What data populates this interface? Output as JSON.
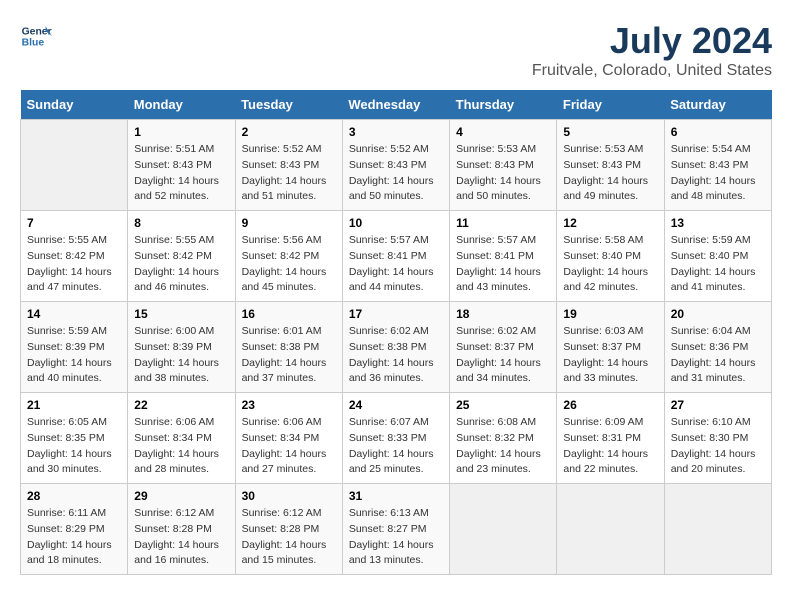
{
  "header": {
    "logo_line1": "General",
    "logo_line2": "Blue",
    "title": "July 2024",
    "subtitle": "Fruitvale, Colorado, United States"
  },
  "calendar": {
    "headers": [
      "Sunday",
      "Monday",
      "Tuesday",
      "Wednesday",
      "Thursday",
      "Friday",
      "Saturday"
    ],
    "weeks": [
      [
        {
          "day": "",
          "info": ""
        },
        {
          "day": "1",
          "info": "Sunrise: 5:51 AM\nSunset: 8:43 PM\nDaylight: 14 hours\nand 52 minutes."
        },
        {
          "day": "2",
          "info": "Sunrise: 5:52 AM\nSunset: 8:43 PM\nDaylight: 14 hours\nand 51 minutes."
        },
        {
          "day": "3",
          "info": "Sunrise: 5:52 AM\nSunset: 8:43 PM\nDaylight: 14 hours\nand 50 minutes."
        },
        {
          "day": "4",
          "info": "Sunrise: 5:53 AM\nSunset: 8:43 PM\nDaylight: 14 hours\nand 50 minutes."
        },
        {
          "day": "5",
          "info": "Sunrise: 5:53 AM\nSunset: 8:43 PM\nDaylight: 14 hours\nand 49 minutes."
        },
        {
          "day": "6",
          "info": "Sunrise: 5:54 AM\nSunset: 8:43 PM\nDaylight: 14 hours\nand 48 minutes."
        }
      ],
      [
        {
          "day": "7",
          "info": "Sunrise: 5:55 AM\nSunset: 8:42 PM\nDaylight: 14 hours\nand 47 minutes."
        },
        {
          "day": "8",
          "info": "Sunrise: 5:55 AM\nSunset: 8:42 PM\nDaylight: 14 hours\nand 46 minutes."
        },
        {
          "day": "9",
          "info": "Sunrise: 5:56 AM\nSunset: 8:42 PM\nDaylight: 14 hours\nand 45 minutes."
        },
        {
          "day": "10",
          "info": "Sunrise: 5:57 AM\nSunset: 8:41 PM\nDaylight: 14 hours\nand 44 minutes."
        },
        {
          "day": "11",
          "info": "Sunrise: 5:57 AM\nSunset: 8:41 PM\nDaylight: 14 hours\nand 43 minutes."
        },
        {
          "day": "12",
          "info": "Sunrise: 5:58 AM\nSunset: 8:40 PM\nDaylight: 14 hours\nand 42 minutes."
        },
        {
          "day": "13",
          "info": "Sunrise: 5:59 AM\nSunset: 8:40 PM\nDaylight: 14 hours\nand 41 minutes."
        }
      ],
      [
        {
          "day": "14",
          "info": "Sunrise: 5:59 AM\nSunset: 8:39 PM\nDaylight: 14 hours\nand 40 minutes."
        },
        {
          "day": "15",
          "info": "Sunrise: 6:00 AM\nSunset: 8:39 PM\nDaylight: 14 hours\nand 38 minutes."
        },
        {
          "day": "16",
          "info": "Sunrise: 6:01 AM\nSunset: 8:38 PM\nDaylight: 14 hours\nand 37 minutes."
        },
        {
          "day": "17",
          "info": "Sunrise: 6:02 AM\nSunset: 8:38 PM\nDaylight: 14 hours\nand 36 minutes."
        },
        {
          "day": "18",
          "info": "Sunrise: 6:02 AM\nSunset: 8:37 PM\nDaylight: 14 hours\nand 34 minutes."
        },
        {
          "day": "19",
          "info": "Sunrise: 6:03 AM\nSunset: 8:37 PM\nDaylight: 14 hours\nand 33 minutes."
        },
        {
          "day": "20",
          "info": "Sunrise: 6:04 AM\nSunset: 8:36 PM\nDaylight: 14 hours\nand 31 minutes."
        }
      ],
      [
        {
          "day": "21",
          "info": "Sunrise: 6:05 AM\nSunset: 8:35 PM\nDaylight: 14 hours\nand 30 minutes."
        },
        {
          "day": "22",
          "info": "Sunrise: 6:06 AM\nSunset: 8:34 PM\nDaylight: 14 hours\nand 28 minutes."
        },
        {
          "day": "23",
          "info": "Sunrise: 6:06 AM\nSunset: 8:34 PM\nDaylight: 14 hours\nand 27 minutes."
        },
        {
          "day": "24",
          "info": "Sunrise: 6:07 AM\nSunset: 8:33 PM\nDaylight: 14 hours\nand 25 minutes."
        },
        {
          "day": "25",
          "info": "Sunrise: 6:08 AM\nSunset: 8:32 PM\nDaylight: 14 hours\nand 23 minutes."
        },
        {
          "day": "26",
          "info": "Sunrise: 6:09 AM\nSunset: 8:31 PM\nDaylight: 14 hours\nand 22 minutes."
        },
        {
          "day": "27",
          "info": "Sunrise: 6:10 AM\nSunset: 8:30 PM\nDaylight: 14 hours\nand 20 minutes."
        }
      ],
      [
        {
          "day": "28",
          "info": "Sunrise: 6:11 AM\nSunset: 8:29 PM\nDaylight: 14 hours\nand 18 minutes."
        },
        {
          "day": "29",
          "info": "Sunrise: 6:12 AM\nSunset: 8:28 PM\nDaylight: 14 hours\nand 16 minutes."
        },
        {
          "day": "30",
          "info": "Sunrise: 6:12 AM\nSunset: 8:28 PM\nDaylight: 14 hours\nand 15 minutes."
        },
        {
          "day": "31",
          "info": "Sunrise: 6:13 AM\nSunset: 8:27 PM\nDaylight: 14 hours\nand 13 minutes."
        },
        {
          "day": "",
          "info": ""
        },
        {
          "day": "",
          "info": ""
        },
        {
          "day": "",
          "info": ""
        }
      ]
    ]
  }
}
